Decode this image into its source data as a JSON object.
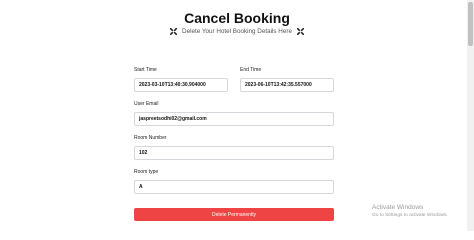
{
  "header": {
    "title": "Cancel Booking",
    "subtitle": "Delete Your Hotel Booking Details Here",
    "left_icon": "x-cross-icon",
    "right_icon": "x-cross-icon"
  },
  "form": {
    "start_time": {
      "label": "Start Time",
      "value": "2023-03-10T13:40:30.904000"
    },
    "end_time": {
      "label": "End Time",
      "value": "2023-06-10T13:42:35.557000"
    },
    "user_email": {
      "label": "User Email",
      "value": "jaspreetsodhi02@gmail.com"
    },
    "room_number": {
      "label": "Room Number",
      "value": "102"
    },
    "room_type": {
      "label": "Room type",
      "value": "A"
    }
  },
  "actions": {
    "delete_label": "Delete Permanently",
    "delete_color": "#ef4444"
  },
  "watermark": {
    "title": "Activate Windows",
    "subtitle": "Go to Settings to activate Windows."
  }
}
